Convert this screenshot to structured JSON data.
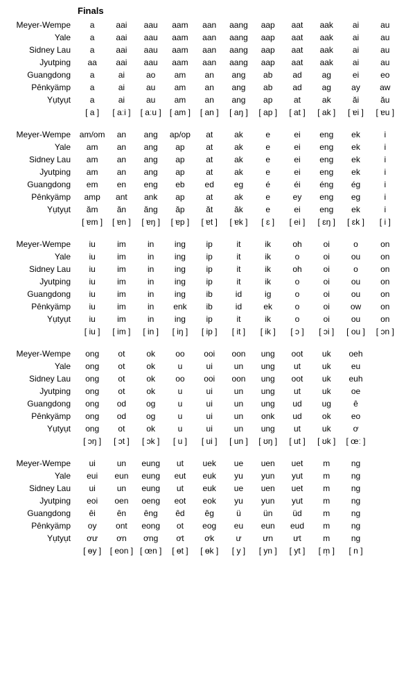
{
  "title": "Finals",
  "systems": [
    "Meyer-Wempe",
    "Yale",
    "Sidney Lau",
    "Jyutping",
    "Guangdong",
    "Pênkyämp",
    "Yụtyụt"
  ],
  "blocks": [
    {
      "columns": 11,
      "rows": [
        [
          "a",
          "aai",
          "aau",
          "aam",
          "aan",
          "aang",
          "aap",
          "aat",
          "aak",
          "ai",
          "au"
        ],
        [
          "a",
          "aai",
          "aau",
          "aam",
          "aan",
          "aang",
          "aap",
          "aat",
          "aak",
          "ai",
          "au"
        ],
        [
          "a",
          "aai",
          "aau",
          "aam",
          "aan",
          "aang",
          "aap",
          "aat",
          "aak",
          "ai",
          "au"
        ],
        [
          "aa",
          "aai",
          "aau",
          "aam",
          "aan",
          "aang",
          "aap",
          "aat",
          "aak",
          "ai",
          "au"
        ],
        [
          "a",
          "ai",
          "ao",
          "am",
          "an",
          "ang",
          "ab",
          "ad",
          "ag",
          "ei",
          "eo"
        ],
        [
          "a",
          "ai",
          "au",
          "am",
          "an",
          "ang",
          "ab",
          "ad",
          "ag",
          "ay",
          "aw"
        ],
        [
          "a",
          "ai",
          "au",
          "am",
          "an",
          "ang",
          "ap",
          "at",
          "ak",
          "ăi",
          "ău"
        ]
      ],
      "ipa": [
        "[ a ]",
        "[ aːi ]",
        "[ aːu ]",
        "[ am ]",
        "[ an ]",
        "[ aŋ ]",
        "[ ap ]",
        "[ at ]",
        "[ ak ]",
        "[ ɐi ]",
        "[ ɐu ]"
      ]
    },
    {
      "columns": 11,
      "rows": [
        [
          "am/om",
          "an",
          "ang",
          "ap/op",
          "at",
          "ak",
          "e",
          "ei",
          "eng",
          "ek",
          "i"
        ],
        [
          "am",
          "an",
          "ang",
          "ap",
          "at",
          "ak",
          "e",
          "ei",
          "eng",
          "ek",
          "i"
        ],
        [
          "am",
          "an",
          "ang",
          "ap",
          "at",
          "ak",
          "e",
          "ei",
          "eng",
          "ek",
          "i"
        ],
        [
          "am",
          "an",
          "ang",
          "ap",
          "at",
          "ak",
          "e",
          "ei",
          "eng",
          "ek",
          "i"
        ],
        [
          "em",
          "en",
          "eng",
          "eb",
          "ed",
          "eg",
          "é",
          "éi",
          "éng",
          "ég",
          "i"
        ],
        [
          "amp",
          "ant",
          "ank",
          "ap",
          "at",
          "ak",
          "e",
          "ey",
          "eng",
          "eg",
          "i"
        ],
        [
          "ăm",
          "ăn",
          "ăng",
          "ăp",
          "ăt",
          "ăk",
          "e",
          "ei",
          "eng",
          "ek",
          "i"
        ]
      ],
      "ipa": [
        "[ ɐm ]",
        "[ ɐn ]",
        "[ ɐŋ ]",
        "[ ɐp ]",
        "[ ɐt ]",
        "[ ɐk ]",
        "[ ɛ ]",
        "[ ei ]",
        "[ ɛŋ ]",
        "[ ɛk ]",
        "[ i ]"
      ]
    },
    {
      "columns": 11,
      "rows": [
        [
          "iu",
          "im",
          "in",
          "ing",
          "ip",
          "it",
          "ik",
          "oh",
          "oi",
          "o",
          "on"
        ],
        [
          "iu",
          "im",
          "in",
          "ing",
          "ip",
          "it",
          "ik",
          "o",
          "oi",
          "ou",
          "on"
        ],
        [
          "iu",
          "im",
          "in",
          "ing",
          "ip",
          "it",
          "ik",
          "oh",
          "oi",
          "o",
          "on"
        ],
        [
          "iu",
          "im",
          "in",
          "ing",
          "ip",
          "it",
          "ik",
          "o",
          "oi",
          "ou",
          "on"
        ],
        [
          "iu",
          "im",
          "in",
          "ing",
          "ib",
          "id",
          "ig",
          "o",
          "oi",
          "ou",
          "on"
        ],
        [
          "iu",
          "im",
          "in",
          "enk",
          "ib",
          "id",
          "ek",
          "o",
          "oi",
          "ow",
          "on"
        ],
        [
          "iu",
          "im",
          "in",
          "ing",
          "ip",
          "it",
          "ik",
          "o",
          "oi",
          "ou",
          "on"
        ]
      ],
      "ipa": [
        "[ iu ]",
        "[ im ]",
        "[ in ]",
        "[ iŋ ]",
        "[ ip ]",
        "[ it ]",
        "[ ik ]",
        "[ ɔ ]",
        "[ ɔi ]",
        "[ ou ]",
        "[ ɔn ]"
      ]
    },
    {
      "columns": 11,
      "rows": [
        [
          "ong",
          "ot",
          "ok",
          "oo",
          "ooi",
          "oon",
          "ung",
          "oot",
          "uk",
          "oeh",
          ""
        ],
        [
          "ong",
          "ot",
          "ok",
          "u",
          "ui",
          "un",
          "ung",
          "ut",
          "uk",
          "eu",
          ""
        ],
        [
          "ong",
          "ot",
          "ok",
          "oo",
          "ooi",
          "oon",
          "ung",
          "oot",
          "uk",
          "euh",
          ""
        ],
        [
          "ong",
          "ot",
          "ok",
          "u",
          "ui",
          "un",
          "ung",
          "ut",
          "uk",
          "oe",
          ""
        ],
        [
          "ong",
          "od",
          "og",
          "u",
          "ui",
          "un",
          "ung",
          "ud",
          "ug",
          "ê",
          ""
        ],
        [
          "ong",
          "od",
          "og",
          "u",
          "ui",
          "un",
          "onk",
          "ud",
          "ok",
          "eo",
          ""
        ],
        [
          "ong",
          "ot",
          "ok",
          "u",
          "ui",
          "un",
          "ung",
          "ut",
          "uk",
          "ơ",
          ""
        ]
      ],
      "ipa": [
        "[ ɔŋ ]",
        "[ ɔt ]",
        "[ ɔk ]",
        "[ u ]",
        "[ ui ]",
        "[ un ]",
        "[ ʊŋ ]",
        "[ ut ]",
        "[ ʊk ]",
        "[ œː ]",
        ""
      ]
    },
    {
      "columns": 11,
      "rows": [
        [
          "ui",
          "un",
          "eung",
          "ut",
          "uek",
          "ue",
          "uen",
          "uet",
          "m",
          "ng",
          ""
        ],
        [
          "eui",
          "eun",
          "eung",
          "eut",
          "euk",
          "yu",
          "yun",
          "yut",
          "m",
          "ng",
          ""
        ],
        [
          "ui",
          "un",
          "eung",
          "ut",
          "euk",
          "ue",
          "uen",
          "uet",
          "m",
          "ng",
          ""
        ],
        [
          "eoi",
          "oen",
          "oeng",
          "eot",
          "eok",
          "yu",
          "yun",
          "yut",
          "m",
          "ng",
          ""
        ],
        [
          "êi",
          "ên",
          "êng",
          "êd",
          "êg",
          "ü",
          "ün",
          "üd",
          "m",
          "ng",
          ""
        ],
        [
          "oy",
          "ont",
          "eong",
          "ot",
          "eog",
          "eu",
          "eun",
          "eud",
          "m",
          "ng",
          ""
        ],
        [
          "ơư",
          "ơn",
          "ơng",
          "ơt",
          "ơk",
          "ư",
          "ưn",
          "ưt",
          "m",
          "ng",
          ""
        ]
      ],
      "ipa": [
        "[ ɵy ]",
        "[ eon ]",
        "[ œn ]",
        "[ ɵt ]",
        "[ ɵk ]",
        "[ y ]",
        "[ yn ]",
        "[ yt ]",
        "[ m̩ ]",
        "[ n ]",
        ""
      ]
    }
  ]
}
